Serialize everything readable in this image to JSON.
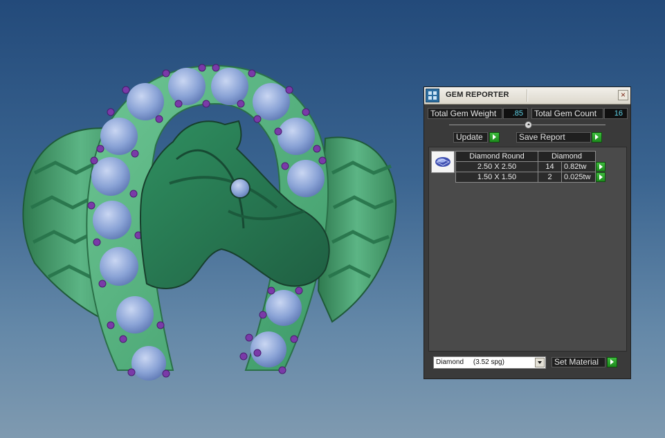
{
  "panel": {
    "title": "GEM REPORTER",
    "total_gem_weight_label": "Total Gem Weight",
    "total_gem_weight_value": ".85",
    "total_gem_count_label": "Total Gem Count",
    "total_gem_count_value": "16",
    "update_label": "Update",
    "save_report_label": "Save Report",
    "table": {
      "header_shape": "Diamond Round",
      "header_material": "Diamond",
      "rows": [
        {
          "size": "2.50 X 2.50",
          "count": "14",
          "weight": "0.82tw"
        },
        {
          "size": "1.50 X 1.50",
          "count": "2",
          "weight": "0.025tw"
        }
      ]
    },
    "material_select_value": "Diamond     (3.52 spg)",
    "set_material_label": "Set Material"
  },
  "icons": [
    "app-icon",
    "close-icon",
    "slider-thumb-icon",
    "gem-thumbnail-icon",
    "play-arrow-icon",
    "dropdown-arrow-icon"
  ],
  "colors": {
    "viewport_top": "#234a7a",
    "viewport_bottom": "#7f9ab0",
    "ring_green": "#3d9a68",
    "gem_blue": "#8aa3d6",
    "accent_purple": "#7a3aa8",
    "value_text": "#5fd3e8",
    "go_button": "#2fa82f"
  }
}
